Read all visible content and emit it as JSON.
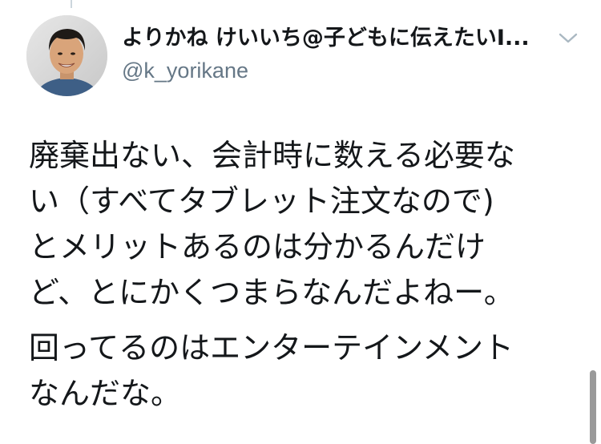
{
  "tweet": {
    "author": {
      "display_name": "よりかね けいいち@子どもに伝えたいI...",
      "handle": "@k_yorikane",
      "avatar_icon": "profile-photo"
    },
    "menu_icon": "chevron-down-icon",
    "body_lines": [
      [
        "廃棄出ない、会計時に数える必要な",
        "い（すべてタブレット注文なので)",
        "とメリットあるのは分かるんだけ",
        "ど、とにかくつまらなんだよねー。"
      ],
      [
        "回ってるのはエンターテインメント",
        "なんだな。"
      ]
    ]
  },
  "colors": {
    "text": "#14171a",
    "secondary_text": "#657786",
    "chevron": "#aab8c2"
  }
}
